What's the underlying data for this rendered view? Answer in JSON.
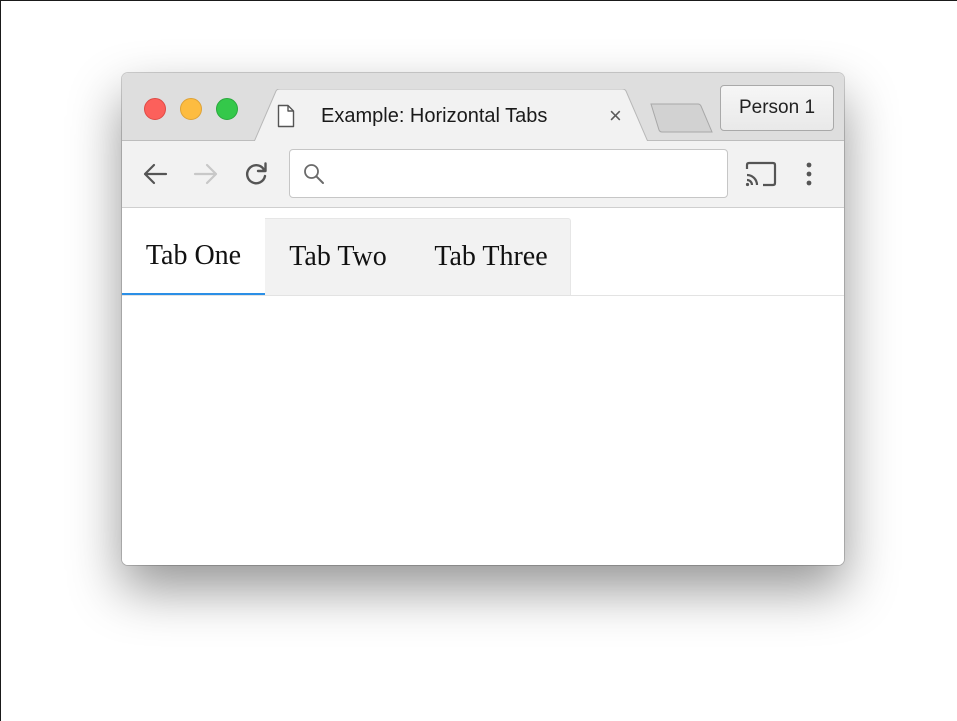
{
  "window": {
    "tab_title": "Example: Horizontal Tabs",
    "tab_close_glyph": "×",
    "profile_label": "Person 1"
  },
  "toolbar": {
    "back_icon": "arrow-left-icon",
    "forward_icon": "arrow-right-icon",
    "reload_icon": "reload-icon",
    "search_icon": "search-icon",
    "address_value": "",
    "cast_icon": "cast-icon",
    "menu_icon": "kebab-menu-icon"
  },
  "page": {
    "tabs": [
      {
        "label": "Tab One",
        "selected": true
      },
      {
        "label": "Tab Two",
        "selected": false
      },
      {
        "label": "Tab Three",
        "selected": false
      }
    ]
  },
  "colors": {
    "close": "#fc605b",
    "minimize": "#fdbc40",
    "maximize": "#34c84a",
    "tab_indicator": "#2b8fe6",
    "tabs_background": "#f2f2f2"
  }
}
